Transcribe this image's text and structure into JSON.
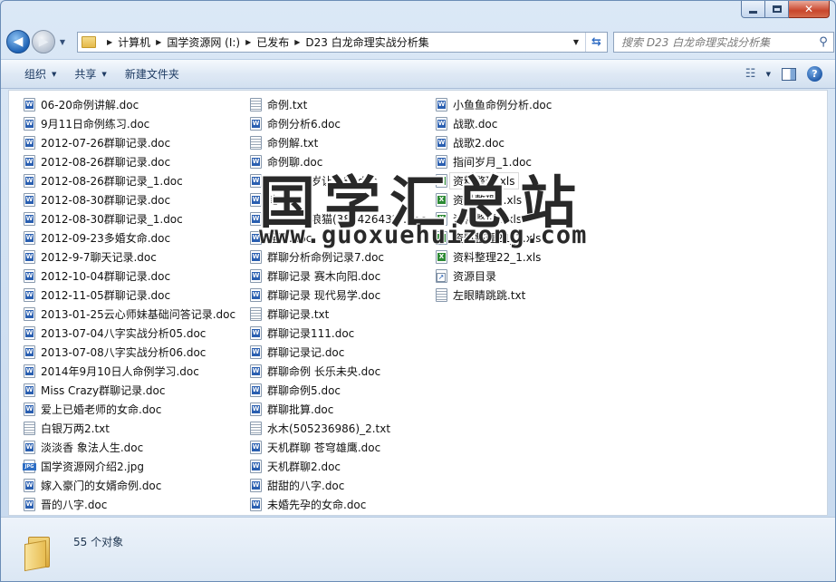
{
  "window": {
    "caption": {
      "minimize": "",
      "maximize": "",
      "close": "✕"
    }
  },
  "nav": {
    "breadcrumbs": [
      "计算机",
      "国学资源网 (I:)",
      "已发布",
      "D23 白龙命理实战分析集"
    ],
    "search_placeholder": "搜索 D23 白龙命理实战分析集"
  },
  "toolbar": {
    "organize": "组织",
    "share": "共享",
    "new_folder": "新建文件夹"
  },
  "files": {
    "col1": [
      {
        "name": "06-20命例讲解.doc",
        "type": "doc"
      },
      {
        "name": "9月11日命例练习.doc",
        "type": "doc"
      },
      {
        "name": "2012-07-26群聊记录.doc",
        "type": "doc"
      },
      {
        "name": "2012-08-26群聊记录.doc",
        "type": "doc"
      },
      {
        "name": "2012-08-26群聊记录_1.doc",
        "type": "doc"
      },
      {
        "name": "2012-08-30群聊记录.doc",
        "type": "doc"
      },
      {
        "name": "2012-08-30群聊记录_1.doc",
        "type": "doc"
      },
      {
        "name": "2012-09-23多婚女命.doc",
        "type": "doc"
      },
      {
        "name": "2012-9-7聊天记录.doc",
        "type": "doc"
      },
      {
        "name": "2012-10-04群聊记录.doc",
        "type": "doc"
      },
      {
        "name": "2012-11-05群聊记录.doc",
        "type": "doc"
      },
      {
        "name": "2013-01-25云心师妹基础问答记录.doc",
        "type": "doc"
      },
      {
        "name": "2013-07-04八字实战分析05.doc",
        "type": "doc"
      },
      {
        "name": "2013-07-08八字实战分析06.doc",
        "type": "doc"
      },
      {
        "name": "2014年9月10日人命例学习.doc",
        "type": "doc"
      },
      {
        "name": "Miss Crazy群聊记录.doc",
        "type": "doc"
      },
      {
        "name": "爱上已婚老师的女命.doc",
        "type": "doc"
      },
      {
        "name": "白银万两2.txt",
        "type": "txt"
      },
      {
        "name": "淡淡香 象法人生.doc",
        "type": "doc"
      },
      {
        "name": "国学资源网介绍2.jpg",
        "type": "jpg"
      },
      {
        "name": "嫁入豪门的女婿命例.doc",
        "type": "doc"
      },
      {
        "name": "晋的八字.doc",
        "type": "doc"
      }
    ],
    "col2": [
      {
        "name": "命例.txt",
        "type": "txt"
      },
      {
        "name": "命例分析6.doc",
        "type": "doc"
      },
      {
        "name": "命例解.txt",
        "type": "txt"
      },
      {
        "name": "命例聊.doc",
        "type": "doc"
      },
      {
        "name": "奈何十一岁让爸爸.doc",
        "type": "doc"
      },
      {
        "name": "乾.doc",
        "type": "doc"
      },
      {
        "name": "亲亲蜜尔浪猫(382426432).doc",
        "type": "doc"
      },
      {
        "name": "诠释.doc",
        "type": "doc"
      },
      {
        "name": "群聊分析命例记录7.doc",
        "type": "doc"
      },
      {
        "name": "群聊记录 赛木向阳.doc",
        "type": "doc"
      },
      {
        "name": "群聊记录 现代易学.doc",
        "type": "doc"
      },
      {
        "name": "群聊记录.txt",
        "type": "txt"
      },
      {
        "name": "群聊记录111.doc",
        "type": "doc"
      },
      {
        "name": "群聊记录记.doc",
        "type": "doc"
      },
      {
        "name": "群聊命例 长乐未央.doc",
        "type": "doc"
      },
      {
        "name": "群聊命例5.doc",
        "type": "doc"
      },
      {
        "name": "群聊批算.doc",
        "type": "doc"
      },
      {
        "name": "水木(505236986)_2.txt",
        "type": "txt"
      },
      {
        "name": "天机群聊 苍穹雄鹰.doc",
        "type": "doc"
      },
      {
        "name": "天机群聊2.doc",
        "type": "doc"
      },
      {
        "name": "甜甜的八字.doc",
        "type": "doc"
      },
      {
        "name": "未婚先孕的女命.doc",
        "type": "doc"
      }
    ],
    "col3": [
      {
        "name": "小鱼鱼命例分析.doc",
        "type": "doc"
      },
      {
        "name": "战歌.doc",
        "type": "doc"
      },
      {
        "name": "战歌2.doc",
        "type": "doc"
      },
      {
        "name": "指间岁月_1.doc",
        "type": "doc"
      },
      {
        "name": "资料整理.xls",
        "type": "xls",
        "selected": true
      },
      {
        "name": "资料整理1.xls",
        "type": "xls"
      },
      {
        "name": "资料整理2.xls",
        "type": "xls"
      },
      {
        "name": "资料整理21_1.xls",
        "type": "xls"
      },
      {
        "name": "资料整理22_1.xls",
        "type": "xls"
      },
      {
        "name": "资源目录",
        "type": "lnk"
      },
      {
        "name": "左眼睛跳跳.txt",
        "type": "txt"
      }
    ]
  },
  "watermark": {
    "text": "国学汇总站",
    "url": "www.guoxuehuizong.com"
  },
  "status": {
    "count": "55 个对象"
  }
}
